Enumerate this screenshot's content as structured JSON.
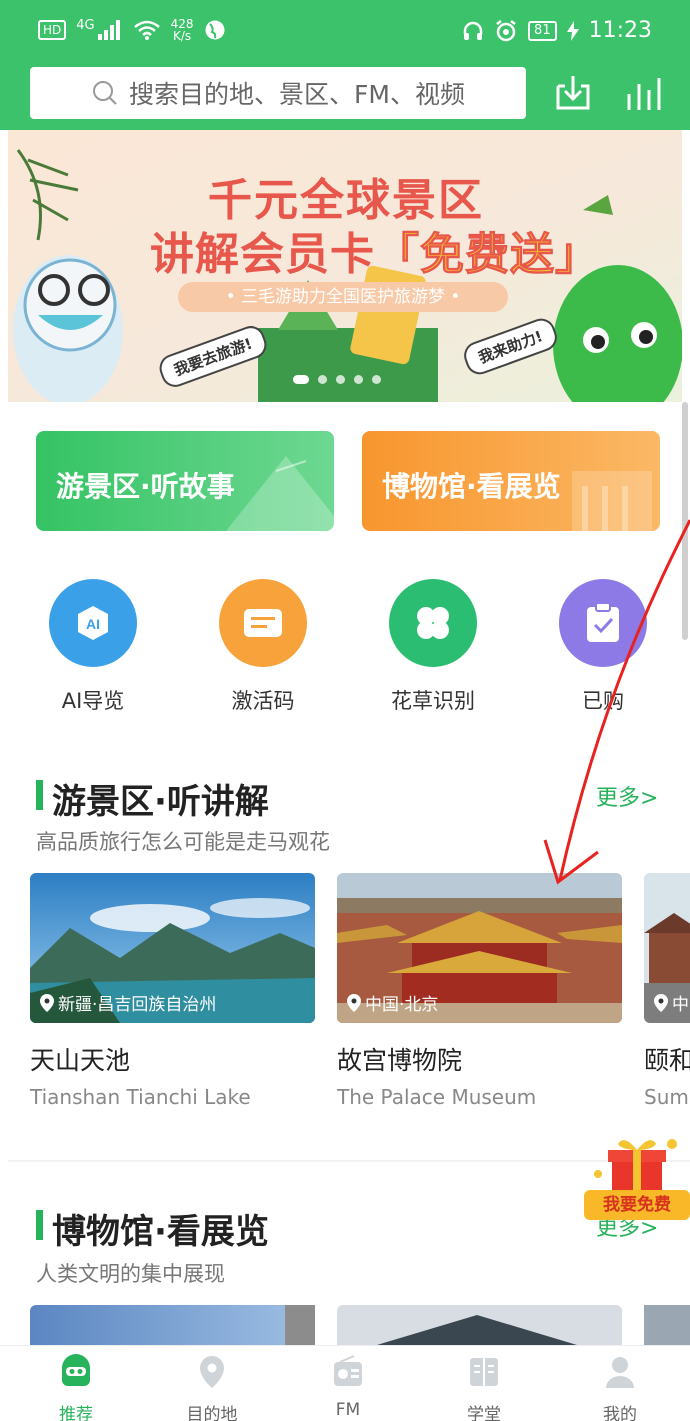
{
  "status_bar": {
    "left_badge": "HD",
    "network": "4G",
    "speed_value": "428",
    "speed_unit": "K/s",
    "battery": "81",
    "time": "11:23"
  },
  "header": {
    "search_placeholder": "搜索目的地、景区、FM、视频"
  },
  "banner": {
    "line1": "千元全球景区",
    "line2_prefix": "讲解会员卡",
    "line2_highlight": "「免费送」",
    "line3": "• 三毛游助力全国医护旅游梦 •",
    "stamp_left": "我要去旅游!",
    "stamp_right": "我来助力!"
  },
  "big_cards": [
    {
      "label": "游景区·听故事"
    },
    {
      "label": "博物馆·看展览"
    }
  ],
  "quick_icons": [
    {
      "label": "AI导览",
      "icon": "ai-icon",
      "color": "#3aa0e8"
    },
    {
      "label": "激活码",
      "icon": "ticket-icon",
      "color": "#f7a23a"
    },
    {
      "label": "花草识别",
      "icon": "clover-icon",
      "color": "#2bbd72"
    },
    {
      "label": "已购",
      "icon": "clipboard-icon",
      "color": "#8d7ae6"
    }
  ],
  "section_scenic": {
    "title": "游景区·听讲解",
    "subtitle": "高品质旅行怎么可能是走马观花",
    "more": "更多>"
  },
  "scenic_cards": [
    {
      "location": "新疆·昌吉回族自治州",
      "name": "天山天池",
      "name_en": "Tianshan Tianchi Lake"
    },
    {
      "location": "中国·北京",
      "name": "故宫博物院",
      "name_en": "The Palace Museum"
    },
    {
      "location": "中",
      "name": "颐和",
      "name_en": "Sum"
    }
  ],
  "section_museum": {
    "title": "博物馆·看展览",
    "subtitle": "人类文明的集中展现",
    "more": "更多>"
  },
  "promo": {
    "label": "我要免费"
  },
  "tabbar": [
    {
      "label": "推荐",
      "icon": "robot-icon"
    },
    {
      "label": "目的地",
      "icon": "map-pin-icon"
    },
    {
      "label": "FM",
      "icon": "radio-icon"
    },
    {
      "label": "学堂",
      "icon": "book-icon"
    },
    {
      "label": "我的",
      "icon": "user-icon"
    }
  ],
  "colors": {
    "brand": "#3cc26a",
    "accent_green": "#27b35b",
    "orange": "#f8962e",
    "annotation": "#e8231f"
  }
}
